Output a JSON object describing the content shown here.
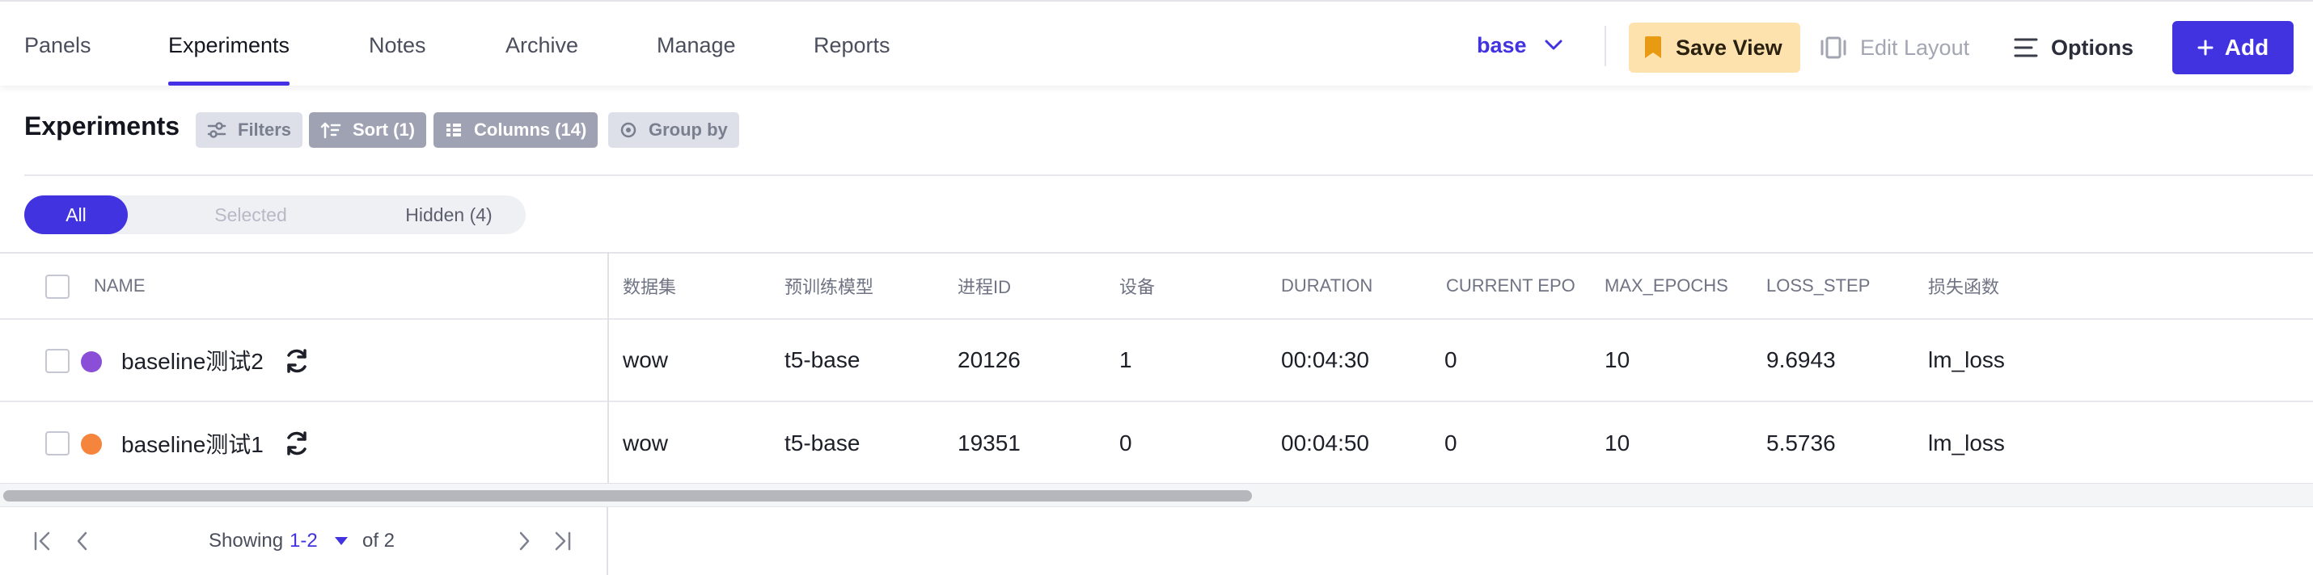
{
  "nav": {
    "tabs": [
      {
        "label": "Panels"
      },
      {
        "label": "Experiments"
      },
      {
        "label": "Notes"
      },
      {
        "label": "Archive"
      },
      {
        "label": "Manage"
      },
      {
        "label": "Reports"
      }
    ],
    "active_tab": "Experiments",
    "view_select": "base",
    "save_view": "Save View",
    "edit_layout": "Edit Layout",
    "options": "Options",
    "add": "Add"
  },
  "toolbar": {
    "title": "Experiments",
    "filters": "Filters",
    "sort": "Sort (1)",
    "columns": "Columns (14)",
    "group_by": "Group by"
  },
  "segments": {
    "all": "All",
    "selected": "Selected",
    "hidden": "Hidden (4)"
  },
  "table": {
    "columns": [
      "NAME",
      "数据集",
      "预训练模型",
      "进程ID",
      "设备",
      "DURATION",
      "CURRENT EPO...",
      "MAX_EPOCHS",
      "LOSS_STEP",
      "损失函数"
    ],
    "rows": [
      {
        "name": "baseline测试2",
        "color": "#8a4fd6",
        "cells": [
          "wow",
          "t5-base",
          "20126",
          "1",
          "00:04:30",
          "0",
          "10",
          "9.6943",
          "lm_loss"
        ]
      },
      {
        "name": "baseline测试1",
        "color": "#f5853c",
        "cells": [
          "wow",
          "t5-base",
          "19351",
          "0",
          "00:04:50",
          "0",
          "10",
          "5.5736",
          "lm_loss"
        ]
      }
    ]
  },
  "pagination": {
    "showing": "Showing",
    "range": "1-2",
    "of": "of 2"
  },
  "colors": {
    "accent": "#4233e0",
    "save_view_bg": "#fde2ae"
  },
  "icons": [
    "bookmark-icon",
    "chevron-down-icon",
    "edit-layout-icon",
    "options-lines-icon",
    "plus-icon",
    "filter-icon",
    "sort-icon",
    "columns-icon",
    "group-by-icon",
    "sync-icon",
    "first-page-icon",
    "prev-page-icon",
    "next-page-icon",
    "last-page-icon",
    "caret-down-icon"
  ]
}
